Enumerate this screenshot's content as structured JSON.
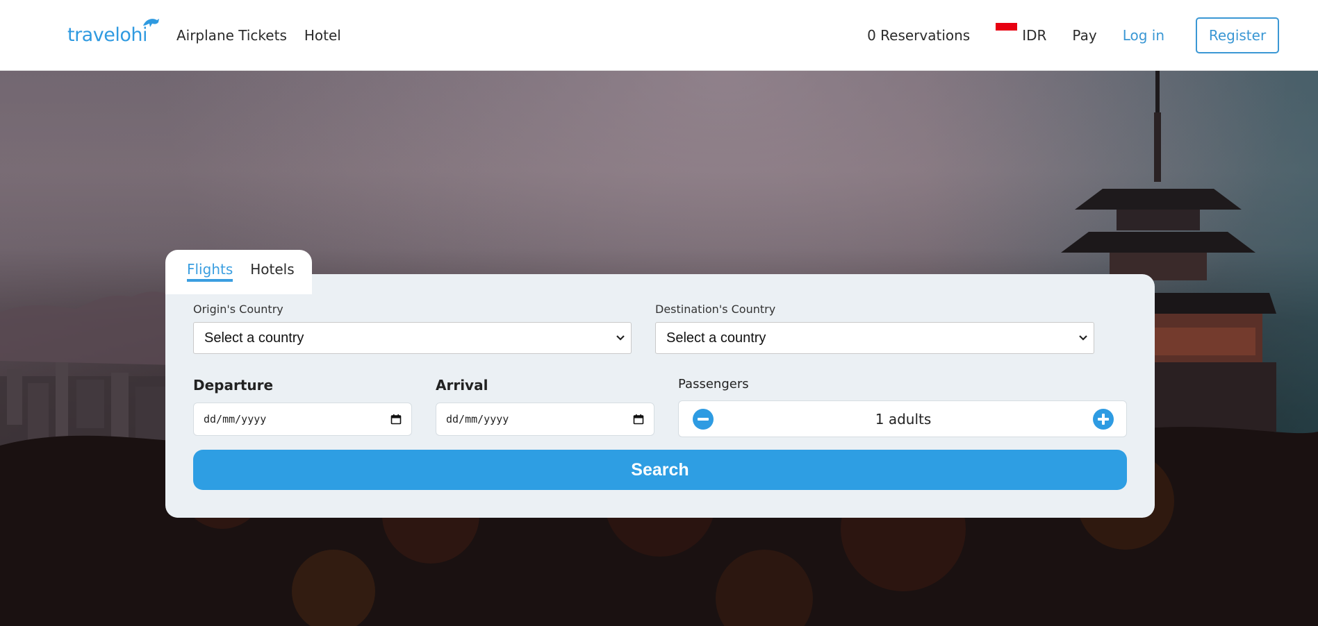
{
  "header": {
    "logo_text": "travelohi",
    "nav": [
      "Airplane Tickets",
      "Hotel"
    ],
    "reservations": "0 Reservations",
    "currency": "IDR",
    "pay": "Pay",
    "login": "Log in",
    "register": "Register"
  },
  "search": {
    "tabs": [
      "Flights",
      "Hotels"
    ],
    "active_tab": "Flights",
    "origin_label": "Origin's Country",
    "origin_value": "Select a country",
    "destination_label": "Destination's Country",
    "destination_value": "Select a country",
    "departure_label": "Departure",
    "departure_value": "dd/mm/yyyy",
    "arrival_label": "Arrival",
    "arrival_value": "dd/mm/yyyy",
    "passengers_label": "Passengers",
    "passengers_value": "1 adults",
    "search_button": "Search"
  },
  "colors": {
    "accent": "#2e9ee3",
    "card_bg": "#ebf0f4",
    "header_bg": "#ffffff"
  },
  "icons": [
    "dolphin-logo-icon",
    "indonesia-flag-icon",
    "chevron-down-icon",
    "calendar-icon",
    "minus-circle-icon",
    "plus-circle-icon"
  ]
}
